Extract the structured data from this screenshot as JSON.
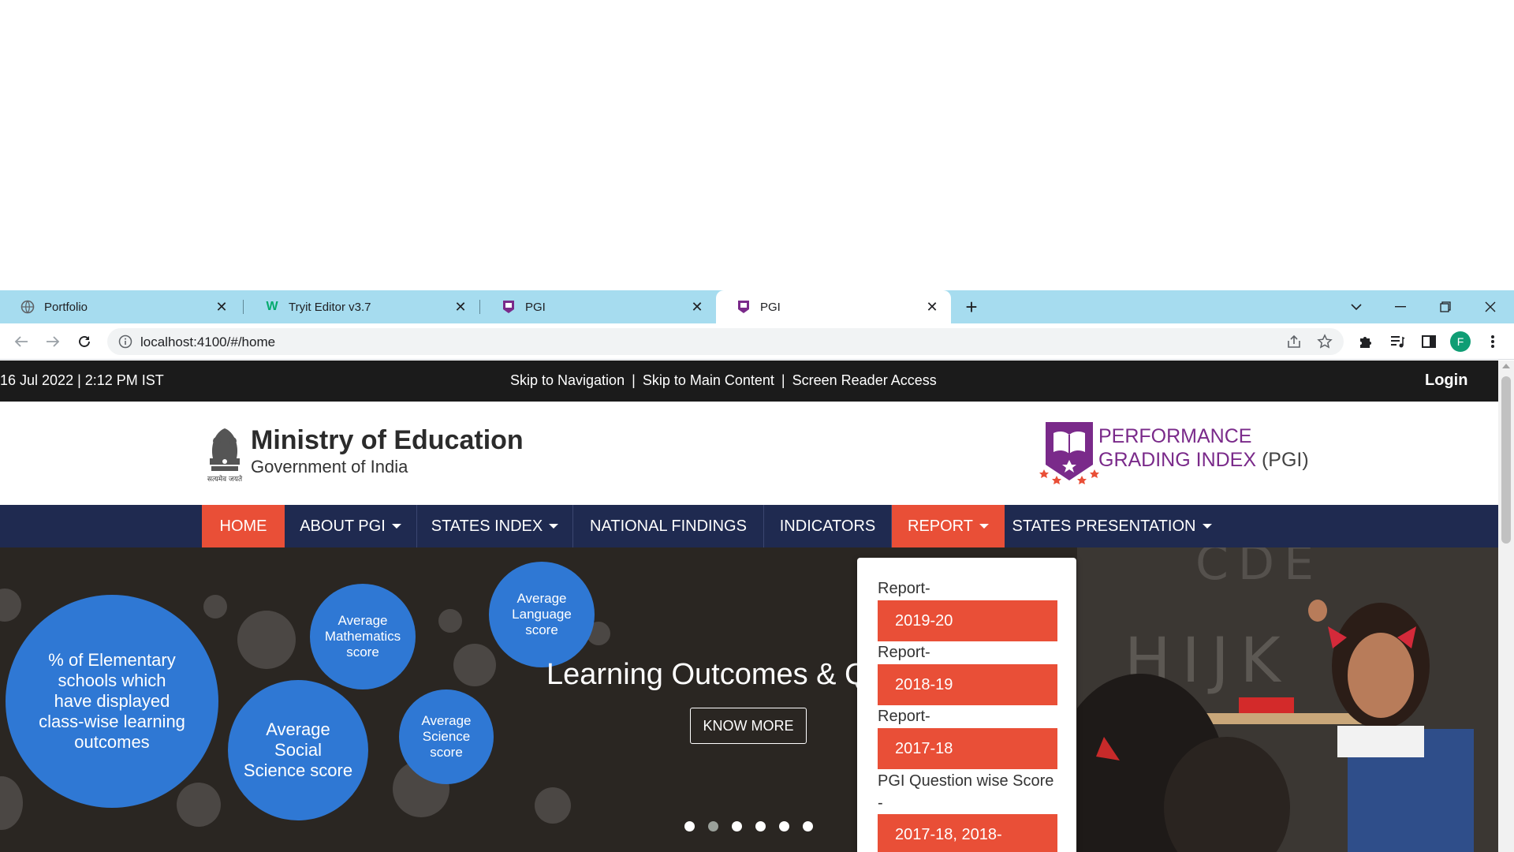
{
  "browser": {
    "tabs": [
      {
        "title": "Portfolio",
        "favicon": "globe-icon"
      },
      {
        "title": "Tryit Editor v3.7",
        "favicon": "w3schools-icon"
      },
      {
        "title": "PGI",
        "favicon": "pgi-icon"
      },
      {
        "title": "PGI",
        "favicon": "pgi-icon"
      }
    ],
    "active_tab_index": 3,
    "url": "localhost:4100/#/home",
    "profile_initial": "F"
  },
  "topbar": {
    "datetime": "16 Jul 2022  |  2:12 PM IST",
    "skip_nav": "Skip to Navigation",
    "skip_main": "Skip to Main Content",
    "screen_reader": "Screen Reader Access",
    "separator": "|",
    "login": "Login"
  },
  "header": {
    "ministry_title": "Ministry of Education",
    "ministry_subtitle": "Government of India",
    "emblem_caption": "सत्यमेव जयते",
    "pgi_line1": "PERFORMANCE",
    "pgi_line2": "GRADING INDEX",
    "pgi_abbr": " (PGI)"
  },
  "nav": {
    "items": [
      {
        "label": "HOME",
        "dropdown": false,
        "active": true
      },
      {
        "label": "ABOUT PGI",
        "dropdown": true,
        "active": false
      },
      {
        "label": "STATES INDEX",
        "dropdown": true,
        "active": false
      },
      {
        "label": "NATIONAL FINDINGS",
        "dropdown": false,
        "active": false
      },
      {
        "label": "INDICATORS",
        "dropdown": false,
        "active": false
      },
      {
        "label": "REPORT",
        "dropdown": true,
        "active": true
      },
      {
        "label": "STATES PRESENTATION",
        "dropdown": true,
        "active": false
      }
    ]
  },
  "hero": {
    "bubbles": [
      "% of Elementary schools which have displayed class-wise learning outcomes",
      "Average Mathematics score",
      "Average Language score",
      "Average Social Science score",
      "Average Science score"
    ],
    "title": "Learning Outcomes & Q",
    "button": "KNOW MORE",
    "slide_count": 6,
    "active_slide": 1
  },
  "report_dropdown": {
    "items": [
      {
        "label": "Report-",
        "button": "2019-20"
      },
      {
        "label": "Report-",
        "button": "2018-19"
      },
      {
        "label": "Report-",
        "button": "2017-18"
      },
      {
        "label": "PGI Question wise Score",
        "label2": "-",
        "button": "2017-18, 2018-"
      }
    ]
  },
  "colors": {
    "accent_red": "#e94f37",
    "nav_navy": "#1f2a50",
    "bubble_blue": "#2f78d4",
    "pgi_purple": "#7a2a8a",
    "tab_strip": "#a6dcef"
  }
}
